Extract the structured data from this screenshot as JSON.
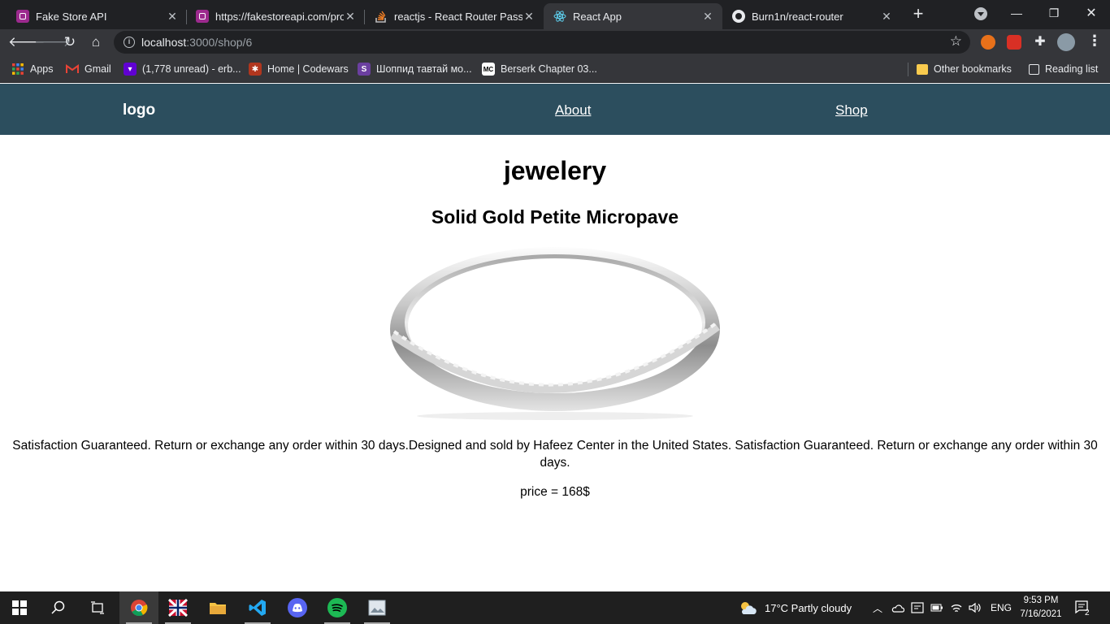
{
  "browser": {
    "tabs": [
      {
        "title": "Fake Store API",
        "icon": "fakestore-favicon"
      },
      {
        "title": "https://fakestoreapi.com/prod",
        "icon": "fakestore-favicon"
      },
      {
        "title": "reactjs - React Router Pass Pa",
        "icon": "stackoverflow-favicon"
      },
      {
        "title": "React App",
        "icon": "react-favicon"
      },
      {
        "title": "Burn1n/react-router",
        "icon": "github-favicon"
      }
    ],
    "url_host": "localhost",
    "url_path": ":3000/shop/6",
    "bookmarks": [
      {
        "label": "Apps",
        "icon": "apps-grid-icon"
      },
      {
        "label": "Gmail",
        "icon": "gmail-icon"
      },
      {
        "label": "(1,778 unread) - erb...",
        "icon": "yahoo-mail-icon"
      },
      {
        "label": "Home | Codewars",
        "icon": "codewars-icon"
      },
      {
        "label": "Шоппид тавтай мо...",
        "icon": "shoppy-icon"
      },
      {
        "label": "Berserk Chapter 03...",
        "icon": "manga-icon"
      }
    ],
    "other_bookmarks": "Other bookmarks",
    "reading_list": "Reading list"
  },
  "header": {
    "logo": "logo",
    "nav": [
      {
        "label": "About"
      },
      {
        "label": "Shop"
      }
    ]
  },
  "product": {
    "category": "jewelery",
    "title": "Solid Gold Petite Micropave",
    "description": "Satisfaction Guaranteed. Return or exchange any order within 30 days.Designed and sold by Hafeez Center in the United States. Satisfaction Guaranteed. Return or exchange any order within 30 days.",
    "price_text": "price = 168$"
  },
  "taskbar": {
    "weather": "17°C  Partly cloudy",
    "language": "ENG",
    "time": "9:53 PM",
    "date": "7/16/2021",
    "notifications": "2"
  },
  "colors": {
    "header_bg": "#2c4e5e",
    "chrome_dark": "#202124",
    "chrome_toolbar": "#35363a"
  }
}
